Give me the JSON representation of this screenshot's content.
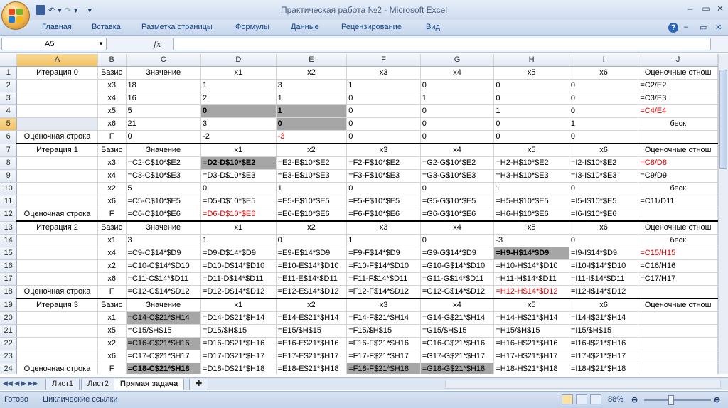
{
  "window": {
    "title": "Практическая работа №2 - Microsoft Excel"
  },
  "qat": {
    "undo_icon": "↶",
    "redo_icon": "↷",
    "dropdown_icon": "▾"
  },
  "ribbon_tabs": [
    "Главная",
    "Вставка",
    "Разметка страницы",
    "Формулы",
    "Данные",
    "Рецензирование",
    "Вид"
  ],
  "formula_bar": {
    "name_box": "A5",
    "fx_label": "fx",
    "formula": ""
  },
  "columns": [
    "",
    "A",
    "B",
    "C",
    "D",
    "E",
    "F",
    "G",
    "H",
    "I",
    "J"
  ],
  "rows": [
    [
      "1",
      "Итерация 0",
      "Базис",
      "Значение",
      "x1",
      "x2",
      "x3",
      "x4",
      "x5",
      "x6",
      "Оценочные отнош"
    ],
    [
      "2",
      "",
      "x3",
      "18",
      "1",
      "3",
      "1",
      "0",
      "0",
      "0",
      "=C2/E2"
    ],
    [
      "3",
      "",
      "x4",
      "16",
      "2",
      "1",
      "0",
      "1",
      "0",
      "0",
      "=C3/E3"
    ],
    [
      "4",
      "",
      "x5",
      "5",
      "0",
      "1",
      "0",
      "0",
      "1",
      "0",
      "=C4/E4"
    ],
    [
      "5",
      "",
      "x6",
      "21",
      "3",
      "0",
      "0",
      "0",
      "0",
      "1",
      "беск"
    ],
    [
      "6",
      "Оценочная строка",
      "F",
      "0",
      "-2",
      "-3",
      "0",
      "0",
      "0",
      "0",
      ""
    ],
    [
      "7",
      "Итерация 1",
      "Базис",
      "Значение",
      "x1",
      "x2",
      "x3",
      "x4",
      "x5",
      "x6",
      "Оценочные отнош"
    ],
    [
      "8",
      "",
      "x3",
      "=C2-C$10*$E2",
      "=D2-D$10*$E2",
      "=E2-E$10*$E2",
      "=F2-F$10*$E2",
      "=G2-G$10*$E2",
      "=H2-H$10*$E2",
      "=I2-I$10*$E2",
      "=C8/D8"
    ],
    [
      "9",
      "",
      "x4",
      "=C3-C$10*$E3",
      "=D3-D$10*$E3",
      "=E3-E$10*$E3",
      "=F3-F$10*$E3",
      "=G3-G$10*$E3",
      "=H3-H$10*$E3",
      "=I3-I$10*$E3",
      "=C9/D9"
    ],
    [
      "10",
      "",
      "x2",
      "5",
      "0",
      "1",
      "0",
      "0",
      "1",
      "0",
      "беск"
    ],
    [
      "11",
      "",
      "x6",
      "=C5-C$10*$E5",
      "=D5-D$10*$E5",
      "=E5-E$10*$E5",
      "=F5-F$10*$E5",
      "=G5-G$10*$E5",
      "=H5-H$10*$E5",
      "=I5-I$10*$E5",
      "=C11/D11"
    ],
    [
      "12",
      "Оценочная строка",
      "F",
      "=C6-C$10*$E6",
      "=D6-D$10*$E6",
      "=E6-E$10*$E6",
      "=F6-F$10*$E6",
      "=G6-G$10*$E6",
      "=H6-H$10*$E6",
      "=I6-I$10*$E6",
      ""
    ],
    [
      "13",
      "Итерация 2",
      "Базис",
      "Значение",
      "x1",
      "x2",
      "x3",
      "x4",
      "x5",
      "x6",
      "Оценочные отнош"
    ],
    [
      "14",
      "",
      "x1",
      "3",
      "1",
      "0",
      "1",
      "0",
      "-3",
      "0",
      "беск"
    ],
    [
      "15",
      "",
      "x4",
      "=C9-C$14*$D9",
      "=D9-D$14*$D9",
      "=E9-E$14*$D9",
      "=F9-F$14*$D9",
      "=G9-G$14*$D9",
      "=H9-H$14*$D9",
      "=I9-I$14*$D9",
      "=C15/H15"
    ],
    [
      "16",
      "",
      "x2",
      "=C10-C$14*$D10",
      "=D10-D$14*$D10",
      "=E10-E$14*$D10",
      "=F10-F$14*$D10",
      "=G10-G$14*$D10",
      "=H10-H$14*$D10",
      "=I10-I$14*$D10",
      "=C16/H16"
    ],
    [
      "17",
      "",
      "x6",
      "=C11-C$14*$D11",
      "=D11-D$14*$D11",
      "=E11-E$14*$D11",
      "=F11-F$14*$D11",
      "=G11-G$14*$D11",
      "=H11-H$14*$D11",
      "=I11-I$14*$D11",
      "=C17/H17"
    ],
    [
      "18",
      "Оценочная строка",
      "F",
      "=C12-C$14*$D12",
      "=D12-D$14*$D12",
      "=E12-E$14*$D12",
      "=F12-F$14*$D12",
      "=G12-G$14*$D12",
      "=H12-H$14*$D12",
      "=I12-I$14*$D12",
      ""
    ],
    [
      "19",
      "Итерация 3",
      "Базис",
      "Значение",
      "x1",
      "x2",
      "x3",
      "x4",
      "x5",
      "x6",
      "Оценочные отнош"
    ],
    [
      "20",
      "",
      "x1",
      "=C14-C$21*$H14",
      "=D14-D$21*$H14",
      "=E14-E$21*$H14",
      "=F14-F$21*$H14",
      "=G14-G$21*$H14",
      "=H14-H$21*$H14",
      "=I14-I$21*$H14",
      ""
    ],
    [
      "21",
      "",
      "x5",
      "=C15/$H$15",
      "=D15/$H$15",
      "=E15/$H$15",
      "=F15/$H$15",
      "=G15/$H$15",
      "=H15/$H$15",
      "=I15/$H$15",
      ""
    ],
    [
      "22",
      "",
      "x2",
      "=C16-C$21*$H16",
      "=D16-D$21*$H16",
      "=E16-E$21*$H16",
      "=F16-F$21*$H16",
      "=G16-G$21*$H16",
      "=H16-H$21*$H16",
      "=I16-I$21*$H16",
      ""
    ],
    [
      "23",
      "",
      "x6",
      "=C17-C$21*$H17",
      "=D17-D$21*$H17",
      "=E17-E$21*$H17",
      "=F17-F$21*$H17",
      "=G17-G$21*$H17",
      "=H17-H$21*$H17",
      "=I17-I$21*$H17",
      ""
    ],
    [
      "24",
      "Оценочная строка",
      "F",
      "=C18-C$21*$H18",
      "=D18-D$21*$H18",
      "=E18-E$21*$H18",
      "=F18-F$21*$H18",
      "=G18-G$21*$H18",
      "=H18-H$21*$H18",
      "=I18-I$21*$H18",
      ""
    ]
  ],
  "sheet_tabs": [
    "Лист1",
    "Лист2",
    "Прямая задача"
  ],
  "active_sheet": "Прямая задача",
  "status": {
    "ready": "Готово",
    "circular": "Циклические ссылки",
    "zoom": "88%"
  },
  "colors": {
    "accent_red": "#e00000",
    "highlight_gray": "#a6a6a6",
    "selection": "#f1c15f"
  }
}
